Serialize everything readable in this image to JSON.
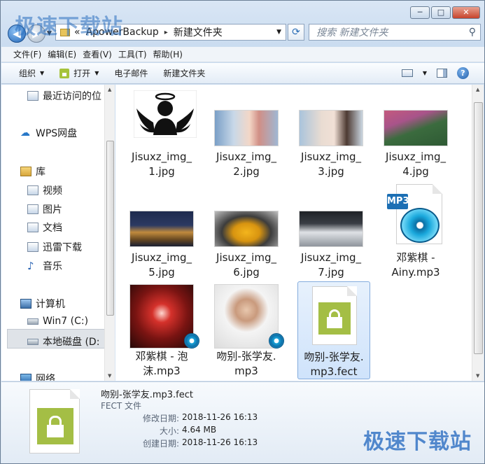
{
  "watermark": "极速下载站",
  "titlebar": {
    "minimize": "─",
    "maximize": "□",
    "close": "✕"
  },
  "address": {
    "segments": [
      "«",
      "ApowerBackup",
      "新建文件夹"
    ],
    "separator": "▸"
  },
  "search": {
    "placeholder": "搜索 新建文件夹"
  },
  "menu": [
    "文件(F)",
    "编辑(E)",
    "查看(V)",
    "工具(T)",
    "帮助(H)"
  ],
  "toolbar": {
    "organize": "组织",
    "open": "打开",
    "email": "电子邮件",
    "new_folder": "新建文件夹",
    "help": "?"
  },
  "nav": {
    "recent": "最近访问的位",
    "wps": "WPS网盘",
    "library": "库",
    "video": "视频",
    "pictures": "图片",
    "documents": "文档",
    "xunlei": "迅雷下载",
    "music": "音乐",
    "computer": "计算机",
    "c_drive": "Win7 (C:)",
    "d_drive": "本地磁盘 (D:",
    "network": "网络"
  },
  "files": [
    {
      "line1": "Jisuxz_img_",
      "line2": "1.jpg"
    },
    {
      "line1": "Jisuxz_img_",
      "line2": "2.jpg"
    },
    {
      "line1": "Jisuxz_img_",
      "line2": "3.jpg"
    },
    {
      "line1": "Jisuxz_img_",
      "line2": "4.jpg"
    },
    {
      "line1": "Jisuxz_img_",
      "line2": "5.jpg"
    },
    {
      "line1": "Jisuxz_img_",
      "line2": "6.jpg"
    },
    {
      "line1": "Jisuxz_img_",
      "line2": "7.jpg"
    },
    {
      "line1": "邓紫棋 -",
      "line2": "Ainy.mp3",
      "badge": "MP3"
    },
    {
      "line1": "邓紫棋 - 泡",
      "line2": "沫.mp3"
    },
    {
      "line1": "吻别-张学友.",
      "line2": "mp3"
    },
    {
      "line1": "吻别-张学友.",
      "line2": "mp3.fect"
    }
  ],
  "details": {
    "name": "吻别-张学友.mp3.fect",
    "type": "FECT 文件",
    "modified_label": "修改日期:",
    "modified": "2018-11-26 16:13",
    "size_label": "大小:",
    "size": "4.64 MB",
    "created_label": "创建日期:",
    "created": "2018-11-26 16:13"
  },
  "colors": {
    "accent": "#2a6db5",
    "fect_green": "#a4be45",
    "selection": "#cfe3fb"
  }
}
